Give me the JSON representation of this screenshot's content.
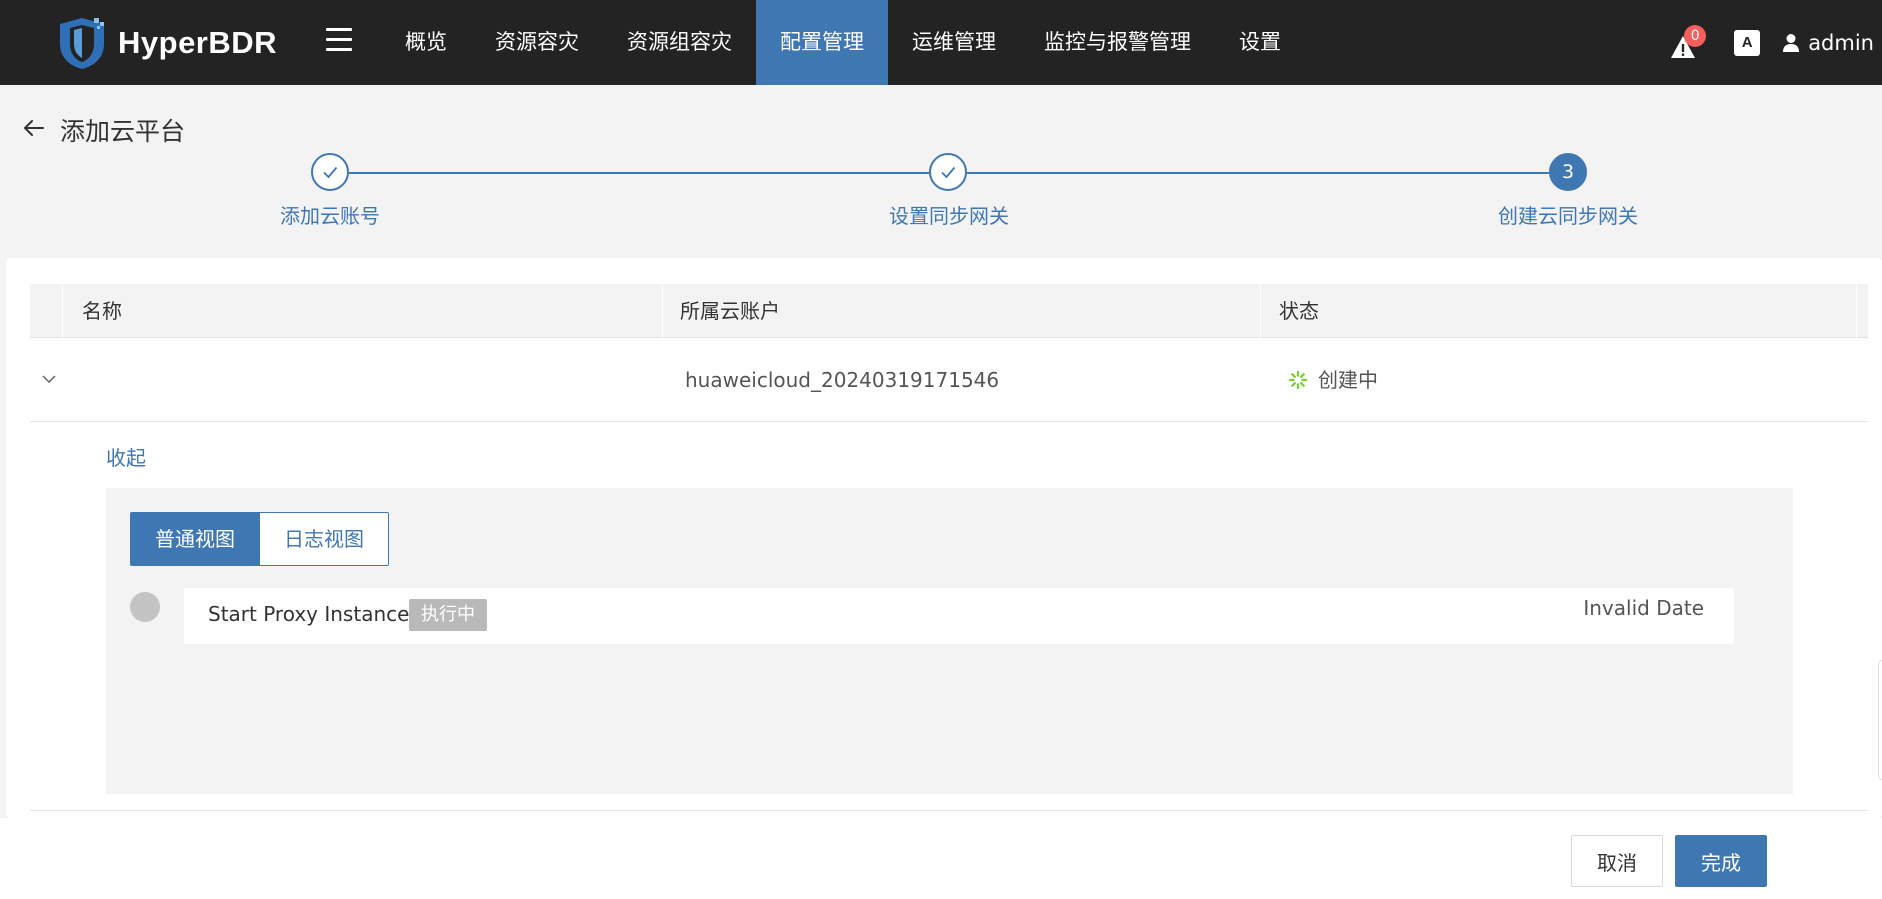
{
  "app": {
    "name": "HyperBDR",
    "logo_icon": "shield-logo-icon"
  },
  "nav": {
    "menu_icon": "hamburger-icon",
    "items": [
      {
        "label": "概览",
        "active": false
      },
      {
        "label": "资源容灾",
        "active": false
      },
      {
        "label": "资源组容灾",
        "active": false
      },
      {
        "label": "配置管理",
        "active": true
      },
      {
        "label": "运维管理",
        "active": false
      },
      {
        "label": "监控与报警管理",
        "active": false
      },
      {
        "label": "设置",
        "active": false
      }
    ]
  },
  "topright": {
    "alert_icon": "warning-icon",
    "alert_count": "0",
    "lang_icon": "translate-icon",
    "lang_glyph": "A",
    "user_icon": "user-icon",
    "user_name": "admin"
  },
  "page": {
    "back_icon": "arrow-left-icon",
    "title": "添加云平台"
  },
  "steps": [
    {
      "label": "添加云账号",
      "status": "done",
      "icon": "check-icon"
    },
    {
      "label": "设置同步网关",
      "status": "done",
      "icon": "check-icon"
    },
    {
      "label": "创建云同步网关",
      "status": "current",
      "number": "3"
    }
  ],
  "table": {
    "columns": [
      "名称",
      "所属云账户",
      "状态"
    ],
    "rows": [
      {
        "name": "",
        "account": "huaweicloud_20240319171546",
        "status": "创建中",
        "status_icon": "loading-spinner-icon",
        "expanded": true
      }
    ]
  },
  "detail": {
    "collapse_label": "收起",
    "views": [
      {
        "label": "普通视图",
        "active": true
      },
      {
        "label": "日志视图",
        "active": false
      }
    ],
    "tasks": [
      {
        "name": "Start Proxy Instance",
        "badge": "执行中",
        "date": "Invalid Date"
      }
    ]
  },
  "footer": {
    "cancel_label": "取消",
    "finish_label": "完成"
  },
  "colors": {
    "primary": "#3f77b3",
    "topbar": "#232323",
    "badge_red": "#f25f5c",
    "spinner_green": "#7fcf3c"
  }
}
